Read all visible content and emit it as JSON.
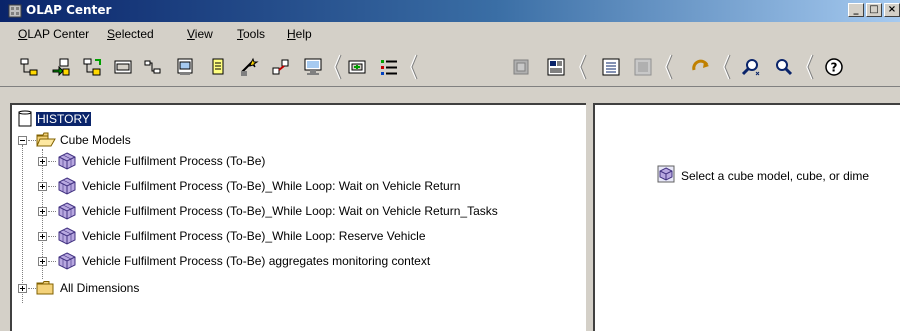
{
  "window": {
    "title": "OLAP Center",
    "buttons": [
      "minimize",
      "maximize",
      "close"
    ]
  },
  "menu": [
    {
      "label": "OLAP Center",
      "mnemonic": "O"
    },
    {
      "label": "Selected",
      "mnemonic": "S"
    },
    {
      "label": "View",
      "mnemonic": "V"
    },
    {
      "label": "Tools",
      "mnemonic": "T"
    },
    {
      "label": "Help",
      "mnemonic": "H"
    }
  ],
  "toolbar": {
    "icons": [
      "connect-icon",
      "import-icon",
      "export-icon",
      "sql-icon",
      "object-flow-icon",
      "properties-icon",
      "notes-icon",
      "wizard-icon",
      "optimize-icon",
      "monitor-icon",
      "display-icon",
      "list-icon",
      "cube-disabled-icon",
      "layout-icon",
      "details-view-icon",
      "details-disabled-icon",
      "refresh-icon",
      "find-icon",
      "find-next-icon",
      "help-icon"
    ]
  },
  "tree": {
    "root": "HISTORY",
    "cube_models_label": "Cube Models",
    "cube_models": [
      "Vehicle Fulfilment Process (To-Be)",
      "Vehicle Fulfilment Process (To-Be)_While Loop: Wait on Vehicle Return",
      "Vehicle Fulfilment Process (To-Be)_While Loop: Wait on Vehicle Return_Tasks",
      "Vehicle Fulfilment Process (To-Be)_While Loop: Reserve Vehicle",
      "Vehicle Fulfilment Process (To-Be) aggregates monitoring context"
    ],
    "all_dimensions_label": "All Dimensions"
  },
  "right_panel": {
    "message": "Select a cube model, cube, or dime"
  },
  "colors": {
    "titlebar_start": "#0a246a",
    "titlebar_end": "#a6caf0",
    "selection": "#0a246a",
    "chrome": "#d4d0c8"
  }
}
